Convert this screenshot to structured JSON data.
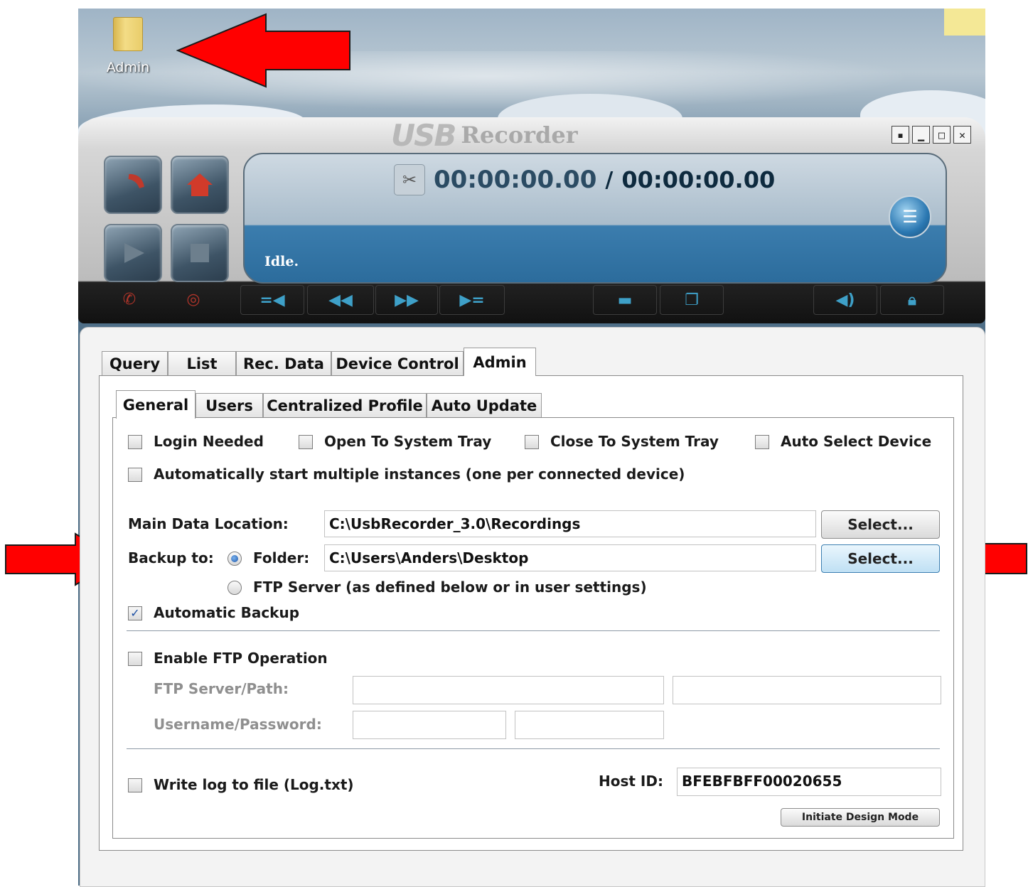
{
  "desktop": {
    "icon_label": "Admin"
  },
  "recorder": {
    "brand_logo": "USB",
    "brand_name": "Recorder",
    "window_buttons": [
      "▪",
      "▁",
      "□",
      "✕"
    ],
    "time_current": "00:00:00.00",
    "time_separator": "/",
    "time_total": "00:00:00.00",
    "status": "Idle."
  },
  "tabs": {
    "top": [
      "Query",
      "List",
      "Rec. Data",
      "Device Control",
      "Admin"
    ],
    "top_active": "Admin",
    "sub": [
      "General",
      "Users",
      "Centralized Profile",
      "Auto Update"
    ],
    "sub_active": "General"
  },
  "general": {
    "login_needed": {
      "label": "Login Needed",
      "checked": false
    },
    "open_to_tray": {
      "label": "Open To System Tray",
      "checked": false
    },
    "close_to_tray": {
      "label": "Close To System Tray",
      "checked": false
    },
    "auto_select": {
      "label": "Auto Select Device",
      "checked": false
    },
    "multi_instances": {
      "label": "Automatically start multiple instances (one per connected device)",
      "checked": false
    },
    "main_data_label": "Main Data Location:",
    "main_data_value": "C:\\UsbRecorder_3.0\\Recordings",
    "select_label": "Select...",
    "backup_label": "Backup to:",
    "folder_label": "Folder:",
    "folder_value": "C:\\Users\\Anders\\Desktop",
    "ftp_server_option": "FTP Server (as defined below or in user settings)",
    "automatic_backup": {
      "label": "Automatic Backup",
      "checked": true
    },
    "enable_ftp": {
      "label": "Enable FTP Operation",
      "checked": false
    },
    "ftp_path_label": "FTP Server/Path:",
    "ftp_user_label": "Username/Password:",
    "ftp_path_value": "",
    "ftp_path_value2": "",
    "ftp_user_value": "",
    "ftp_pass_value": "",
    "write_log": {
      "label": "Write log to file (Log.txt)",
      "checked": false
    },
    "host_id_label": "Host ID:",
    "host_id_value": "BFEBFBFF00020655",
    "design_mode_label": "Initiate Design Mode"
  },
  "colors": {
    "annotation_arrow": "#ff0000",
    "lcd_blue": "#2c6c9c",
    "checkbox_check": "#1c4fa3"
  }
}
